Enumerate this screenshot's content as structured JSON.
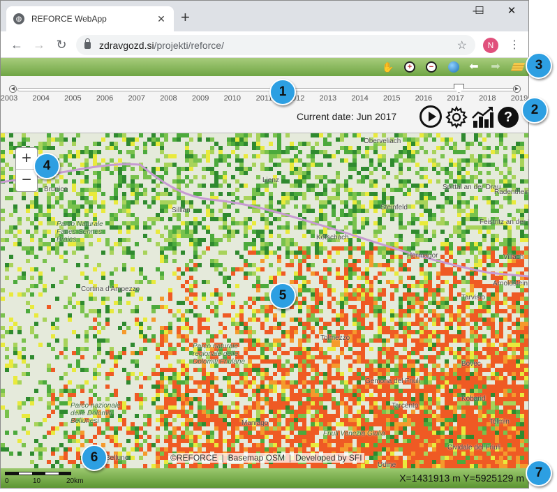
{
  "browser": {
    "tab_title": "REFORCE WebApp",
    "new_tab": "+",
    "url_host": "zdravgozd.si",
    "url_path": "/projekti/reforce/",
    "profile_initial": "N"
  },
  "app_toolbar": {
    "icons": [
      "pan-hand-icon",
      "zoom-in-icon",
      "zoom-out-icon",
      "full-extent-globe-icon",
      "back-arrow-icon",
      "forward-arrow-icon",
      "layers-icon"
    ]
  },
  "timeline": {
    "years": [
      "2003",
      "2004",
      "2005",
      "2006",
      "2007",
      "2008",
      "2009",
      "2010",
      "2011",
      "2012",
      "2013",
      "2014",
      "2015",
      "2016",
      "2017",
      "2018",
      "2019"
    ],
    "selected_year": "2017",
    "current_date_label": "Current date:",
    "current_date_value": "Jun 2017"
  },
  "map": {
    "zoom_in": "+",
    "zoom_out": "−",
    "attribution": [
      "©REFORCE",
      "Basemap OSM",
      "Developed by SFI"
    ],
    "places": [
      {
        "name": "Brunico",
        "style": "normal"
      },
      {
        "name": "Sillian",
        "style": "normal"
      },
      {
        "name": "Lienz",
        "style": "normal"
      },
      {
        "name": "Oberveliach",
        "style": "normal"
      },
      {
        "name": "Spittal an der Drau",
        "style": "normal"
      },
      {
        "name": "Radenthein",
        "style": "normal"
      },
      {
        "name": "Steinfeld",
        "style": "normal"
      },
      {
        "name": "Kötschach",
        "style": "normal"
      },
      {
        "name": "Hermagor",
        "style": "normal"
      },
      {
        "name": "Feistritz an der Drau",
        "style": "normal"
      },
      {
        "name": "Villach",
        "style": "normal"
      },
      {
        "name": "Arnoldstein",
        "style": "normal"
      },
      {
        "name": "Tarvisio",
        "style": "normal"
      },
      {
        "name": "Cortina d'Ampezzo",
        "style": "normal"
      },
      {
        "name": "Tolmezzo",
        "style": "normal"
      },
      {
        "name": "Gemona del Friuli",
        "style": "normal"
      },
      {
        "name": "Tarcento",
        "style": "normal"
      },
      {
        "name": "Maniago",
        "style": "normal"
      },
      {
        "name": "Belluno",
        "style": "normal"
      },
      {
        "name": "Cividale del Friuli",
        "style": "normal"
      },
      {
        "name": "Udine",
        "style": "normal"
      },
      {
        "name": "Kobarid",
        "style": "normal"
      },
      {
        "name": "Tolmin",
        "style": "normal"
      },
      {
        "name": "Bovec",
        "style": "normal"
      },
      {
        "name": "Parco Naturale Fanes-Sennes-Braies",
        "style": "park"
      },
      {
        "name": "Parco naturale regionale delle Dolomiti Friulane",
        "style": "park"
      },
      {
        "name": "Parco nazionale delle Dolomiti Bellunesi",
        "style": "park"
      },
      {
        "name": "Friuli Venezia Giulia",
        "style": "park"
      }
    ]
  },
  "statusbar": {
    "scale_labels": [
      "0",
      "10",
      "20km"
    ],
    "coords": "X=1431913 m Y=5925129 m"
  },
  "callouts": [
    "1",
    "2",
    "3",
    "4",
    "5",
    "6",
    "7"
  ],
  "colors": {
    "toolbar_green_top": "#a7cc7b",
    "toolbar_green_bottom": "#6fa544",
    "callout_blue": "#2d9fe2",
    "damage_orange": "#ef5a24",
    "vegetation_green": "#3f9a3a",
    "vegetation_yellow": "#e9ea3c"
  }
}
